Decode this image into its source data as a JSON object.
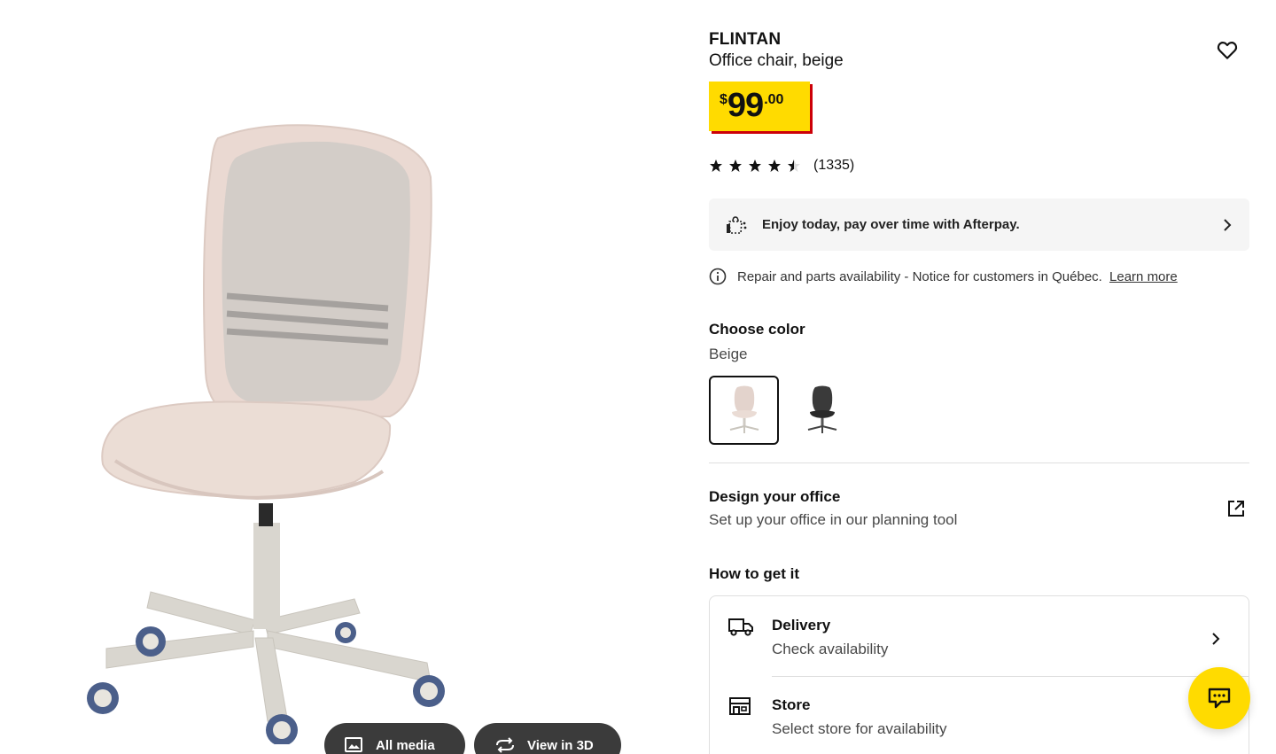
{
  "product": {
    "name": "FLINTAN",
    "description": "Office chair, beige",
    "price": {
      "currency": "$",
      "integer": "99",
      "decimal": ".00"
    },
    "rating": {
      "value": 4.5,
      "max": 5,
      "count": "(1335)"
    }
  },
  "media": {
    "all_media_label": "All media",
    "view_3d_label": "View in 3D"
  },
  "afterpay": {
    "text": "Enjoy today, pay over time with Afterpay."
  },
  "notice": {
    "text": "Repair and parts availability - Notice for customers in Québec.",
    "link": "Learn more"
  },
  "color": {
    "title": "Choose color",
    "selected": "Beige",
    "options": [
      "Beige",
      "Black"
    ]
  },
  "design": {
    "title": "Design your office",
    "subtitle": "Set up your office in our planning tool"
  },
  "how_to_get": {
    "title": "How to get it",
    "delivery": {
      "title": "Delivery",
      "subtitle": "Check availability"
    },
    "store": {
      "title": "Store",
      "subtitle": "Select store for availability"
    }
  },
  "colors": {
    "price_bg": "#ffdb00",
    "price_shadow": "#cc0008",
    "chat_bg": "#ffdb00",
    "media_btn_bg": "#3b3b3b"
  },
  "icons": {
    "favorite": "heart-icon",
    "afterpay": "afterpay-bag-icon",
    "info": "info-icon",
    "external": "external-link-icon",
    "delivery": "truck-icon",
    "store": "store-icon",
    "chat": "chat-icon"
  }
}
